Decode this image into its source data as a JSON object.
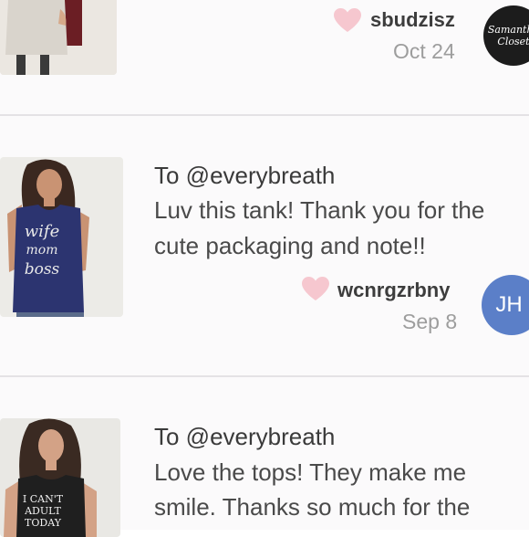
{
  "reviews": [
    {
      "username": "sbudzisz",
      "date": "Oct 24",
      "avatar_text": [
        "Samantha",
        "Closet"
      ],
      "avatar_bg": "#1c1c1c"
    },
    {
      "to": "To @everybreath",
      "message_lines": [
        "Luv this tank! Thank you for the",
        "cute packaging and note!!"
      ],
      "username": "wcnrgzrbny",
      "date": "Sep 8",
      "avatar_text": "JH",
      "avatar_bg": "#5b7fc8",
      "shirt_text": [
        "wife",
        "mom",
        "boss"
      ],
      "shirt_color": "#2c3470"
    },
    {
      "to": "To @everybreath",
      "message_lines": [
        "Love the tops! They make me",
        "smile. Thanks so much for the"
      ],
      "shirt_text": [
        "I CAN'T",
        "ADULT",
        "TODAY"
      ],
      "shirt_color": "#1f1f1f"
    }
  ],
  "colors": {
    "heart": "#f6c7cf",
    "divider": "#e4e2e5",
    "card_bg": "#fbfafb"
  }
}
